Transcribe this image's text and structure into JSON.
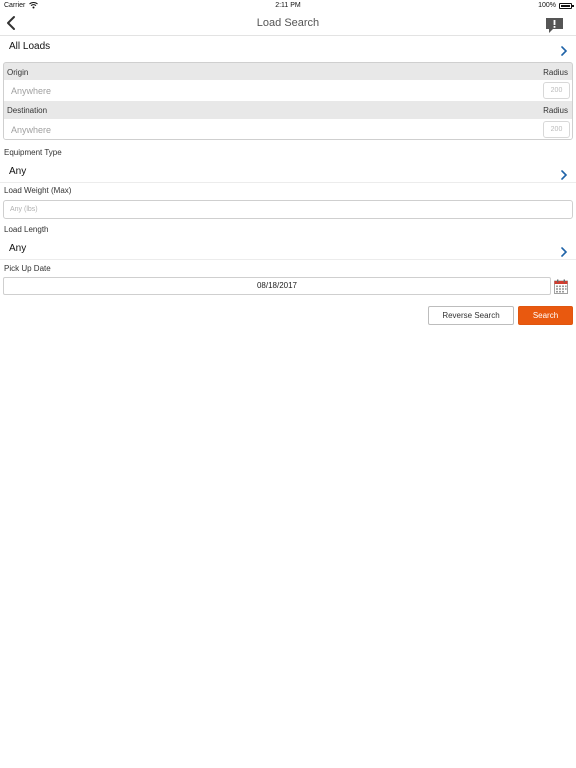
{
  "status_bar": {
    "carrier": "Carrier",
    "time": "2:11 PM",
    "battery": "100%"
  },
  "nav": {
    "title": "Load Search"
  },
  "load_type": {
    "label": "All Loads"
  },
  "origin": {
    "label": "Origin",
    "radius_label": "Radius",
    "placeholder": "Anywhere",
    "radius_placeholder": "200"
  },
  "destination": {
    "label": "Destination",
    "radius_label": "Radius",
    "placeholder": "Anywhere",
    "radius_placeholder": "200"
  },
  "equipment": {
    "label": "Equipment Type",
    "value": "Any"
  },
  "weight": {
    "label": "Load Weight (Max)",
    "placeholder": "Any (lbs)"
  },
  "length": {
    "label": "Load Length",
    "value": "Any"
  },
  "pickup": {
    "label": "Pick Up Date",
    "value": "08/18/2017"
  },
  "actions": {
    "reverse_label": "Reverse Search",
    "search_label": "Search"
  },
  "colors": {
    "accent": "#e9590f",
    "link": "#1f63a8"
  }
}
